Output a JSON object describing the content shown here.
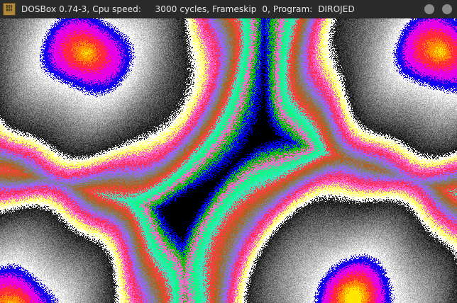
{
  "window": {
    "title": "DOSBox 0.74-3, Cpu speed:     3000 cycles, Frameskip  0, Program:  DIROJED",
    "icon": "dosbox-icon",
    "icon_text": [
      "DOS",
      "BOX"
    ],
    "buttons": [
      "minimize-button",
      "close-button"
    ]
  },
  "game": {
    "program": "DIROJED",
    "palette": [
      "#0000ff",
      "#ff00ff",
      "#ff3060",
      "#ff8000",
      "#ffe000",
      "#ffffff",
      "#ff4040",
      "#ff66cc",
      "#9966ff",
      "#808080",
      "#b06020",
      "#40e0c0",
      "#00ff80",
      "#00c000",
      "#0000a0",
      "#000000"
    ]
  }
}
